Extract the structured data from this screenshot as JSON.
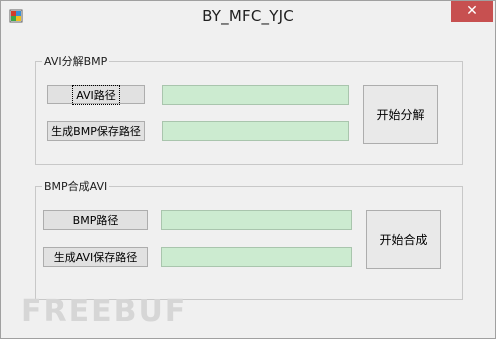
{
  "window": {
    "title": "BY_MFC_YJC",
    "close_glyph": "✕",
    "icon": "mfc-app-icon",
    "close_color": "#c75050"
  },
  "group1": {
    "label": "AVI分解BMP",
    "avi_path_button": "AVI路径",
    "bmp_save_button": "生成BMP保存路径",
    "start_button": "开始分解",
    "avi_path_value": "",
    "bmp_save_value": ""
  },
  "group2": {
    "label": "BMP合成AVI",
    "bmp_path_button": "BMP路径",
    "avi_save_button": "生成AVI保存路径",
    "start_button": "开始合成",
    "bmp_path_value": "",
    "avi_save_value": ""
  },
  "watermark": "FREEBUF",
  "colors": {
    "field_bg": "#ccebd0",
    "window_bg": "#f0f0f0"
  }
}
